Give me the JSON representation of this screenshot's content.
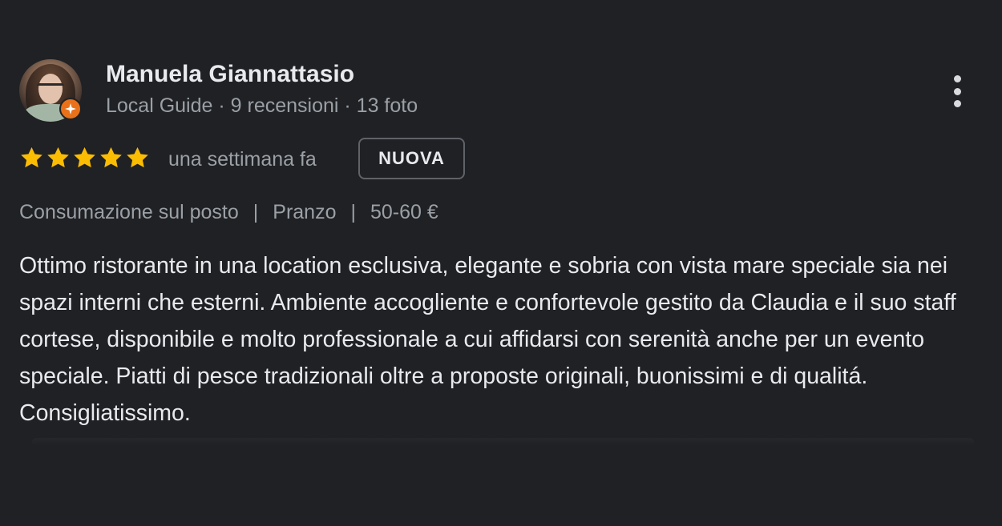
{
  "review": {
    "author": {
      "name": "Manuela Giannattasio",
      "meta": "Local Guide · 9 recensioni · 13 foto",
      "avatar_icon": "user-avatar",
      "badge_icon": "local-guide-star-icon",
      "badge_color": "#e8711a"
    },
    "rating": {
      "stars": 5,
      "max": 5,
      "star_color": "#fbbc04"
    },
    "time": "una settimana fa",
    "new_badge": "NUOVA",
    "tags": {
      "service": "Consumazione sul posto",
      "meal": "Pranzo",
      "price": "50-60 €",
      "separator": "|"
    },
    "text": "Ottimo ristorante in una location esclusiva, elegante e sobria con vista mare speciale sia nei spazi interni che esterni. Ambiente accogliente e confortevole gestito da Claudia e il suo staff cortese, disponibile e molto professionale a cui affidarsi con serenità anche per un evento speciale. Piatti di pesce tradizionali oltre a proposte originali, buonissimi e di qualitá. Consigliatissimo.",
    "more_menu_icon": "more-vertical-icon"
  }
}
